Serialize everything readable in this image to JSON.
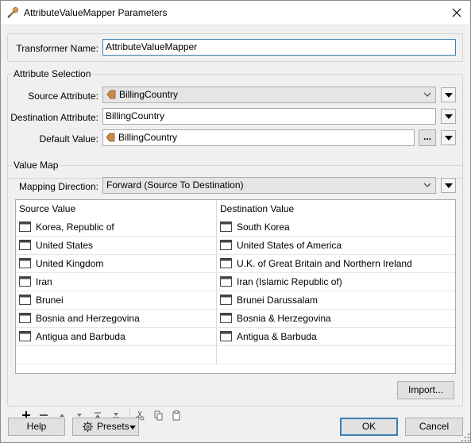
{
  "window": {
    "title": "AttributeValueMapper Parameters"
  },
  "transformer": {
    "label": "Transformer Name:",
    "value": "AttributeValueMapper"
  },
  "attribute_selection": {
    "group_title": "Attribute Selection",
    "source_label": "Source Attribute:",
    "source_value": "BillingCountry",
    "destination_label": "Destination Attribute:",
    "destination_value": "BillingCountry",
    "default_label": "Default Value:",
    "default_value": "BillingCountry",
    "browse_label": "..."
  },
  "value_map": {
    "group_title": "Value Map",
    "direction_label": "Mapping Direction:",
    "direction_value": "Forward (Source To Destination)",
    "columns": [
      "Source Value",
      "Destination Value"
    ],
    "rows": [
      {
        "source": "Korea, Republic of",
        "destination": "South Korea"
      },
      {
        "source": "United States",
        "destination": "United States of America"
      },
      {
        "source": "United Kingdom",
        "destination": "U.K. of Great Britain and Northern Ireland"
      },
      {
        "source": "Iran",
        "destination": "Iran (Islamic Republic of)"
      },
      {
        "source": "Brunei",
        "destination": "Brunei Darussalam"
      },
      {
        "source": "Bosnia and Herzegovina",
        "destination": "Bosnia & Herzegovina"
      },
      {
        "source": "Antigua and Barbuda",
        "destination": "Antigua & Barbuda"
      }
    ],
    "import_label": "Import..."
  },
  "footer": {
    "help_label": "Help",
    "presets_label": "Presets",
    "ok_label": "OK",
    "cancel_label": "Cancel"
  },
  "colors": {
    "dialog_bg": "#f0f0f0",
    "focus_border": "#3c7fb1",
    "attribute_icon": "#c98a4b"
  },
  "icons": {
    "app": "transformer-icon",
    "attribute": "attribute-tag-icon",
    "cell": "text-value-icon",
    "toolbar": [
      "plus-icon",
      "minus-icon",
      "move-up-icon",
      "move-down-icon",
      "move-top-icon",
      "move-bottom-icon",
      "cut-icon",
      "copy-icon",
      "paste-icon"
    ],
    "presets": "gear-icon"
  }
}
